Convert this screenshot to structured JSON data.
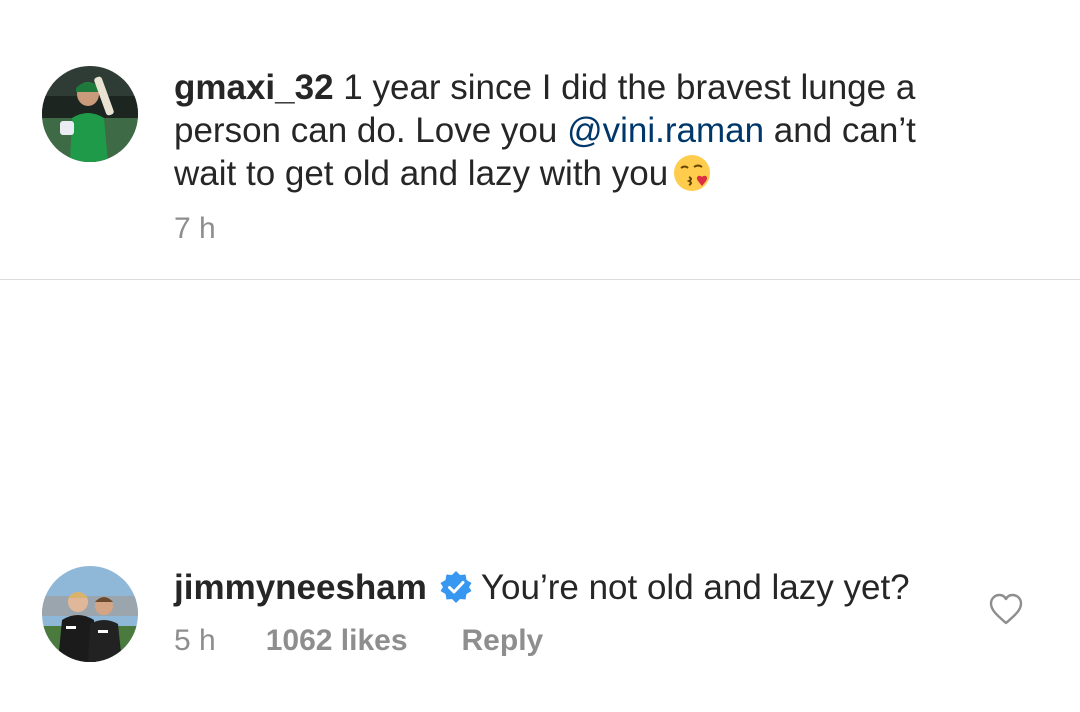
{
  "caption": {
    "username": "gmaxi_32",
    "text_before": " 1 year since I did the bravest lunge a person can do. Love you ",
    "mention": "@vini.raman",
    "text_after": " and can’t wait to get old and lazy with you",
    "emoji": "face-blowing-kiss-icon",
    "timestamp": "7 h"
  },
  "comment": {
    "username": "jimmyneesham",
    "verified": true,
    "text": "You’re not old and lazy yet?",
    "timestamp": "5 h",
    "likes": "1062 likes",
    "reply_label": "Reply",
    "like_icon": "heart-outline-icon"
  },
  "colors": {
    "text": "#262626",
    "secondary": "#8e8e8e",
    "mention": "#00376b",
    "verified_blue": "#3897f0",
    "divider": "#dbdbdb"
  }
}
